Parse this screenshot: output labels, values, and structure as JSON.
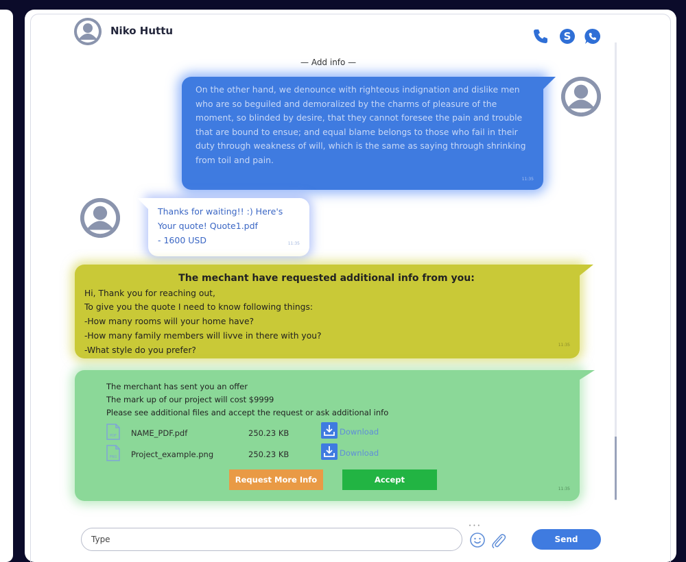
{
  "header": {
    "contact_name": "Niko Huttu",
    "icons": [
      "phone-icon",
      "skype-icon",
      "whatsapp-icon"
    ]
  },
  "divider_label": "— Add info —",
  "messages": {
    "outgoing": {
      "text": "On the other hand, we denounce with righteous indignation and dislike men who are so beguiled and demoralized by the charms of pleasure of the moment, so blinded by desire, that they cannot foresee the pain and trouble that are bound to ensue; and equal blame belongs to those who fail in their duty through weakness of will, which is the same as saying through shrinking from toil and pain.",
      "time": "11:35"
    },
    "incoming": {
      "line1": "Thanks for waiting!! :) Here's",
      "line2": "Your quote! Quote1.pdf",
      "line3": "- 1600 USD",
      "time": "11:35"
    },
    "info_request": {
      "title": "The mechant have requested additional info from you:",
      "lines": [
        "Hi, Thank you for reaching out,",
        "To give you the quote I need to know following things:",
        "-How many rooms will your home have?",
        "-How many family members will livve in there with you?",
        "-What style do you prefer?"
      ],
      "time": "11:35"
    },
    "offer": {
      "lines": [
        "The merchant has sent you an offer",
        "The mark up of our project will cost $9999",
        "Please see additional files and accept the request or ask additional info"
      ],
      "files": [
        {
          "name": "NAME_PDF.pdf",
          "size": "250.23 KB",
          "download": "Download",
          "type_label": "PDF"
        },
        {
          "name": "Project_example.png",
          "size": "250.23 KB",
          "download": "Download",
          "type_label": "PNG"
        }
      ],
      "request_more_label": "Request More Info",
      "accept_label": "Accept",
      "time": "11:35"
    }
  },
  "composer": {
    "placeholder": "Type",
    "send_label": "Send"
  },
  "colors": {
    "outgoing_bubble": "#3f7be0",
    "info_bubble": "#c9c937",
    "offer_bubble": "#8bd898",
    "accept": "#22b443",
    "request_more": "#e99a45",
    "brand_blue": "#2f6fd6"
  }
}
